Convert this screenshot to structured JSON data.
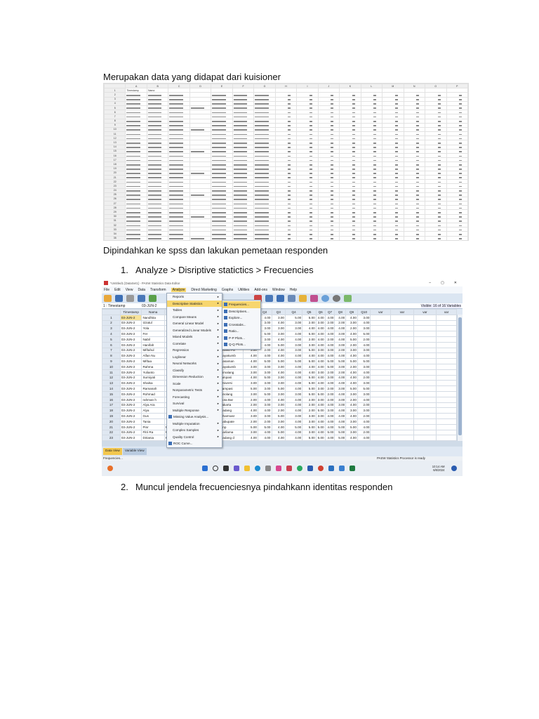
{
  "doc": {
    "intro": "Merupakan data yang didapat dari kuisioner",
    "move": "Dipindahkan ke spss  dan lakukan pemetaan responden",
    "steps": [
      {
        "num": "1.",
        "text": "Analyze > Disriptive statictics > Frecuencies"
      },
      {
        "num": "2.",
        "text": "Muncul jendela frecuenciesnya pindahkann identitas responden"
      }
    ]
  },
  "excel": {
    "columns": [
      "A",
      "B",
      "C",
      "D",
      "E",
      "F",
      "G",
      "H",
      "I",
      "J",
      "K",
      "L",
      "M",
      "N",
      "O",
      "P"
    ],
    "headers": [
      "Timestamp",
      "Nama"
    ],
    "row_count": 35
  },
  "spss": {
    "title": "*Untitled1 [DataSet1] - PASW Statistics Data Editor",
    "window_controls": [
      "–",
      "▢",
      "✕"
    ],
    "menu": [
      "File",
      "Edit",
      "View",
      "Data",
      "Transform",
      "Analyze",
      "Direct Marketing",
      "Graphs",
      "Utilities",
      "Add-ons",
      "Window",
      "Help"
    ],
    "active_menu": "Analyze",
    "cell_ref": "1 : Timestamp",
    "cell_value": "03-JUN-2",
    "visible_vars": "Visible: 16 of 16 Variables",
    "columns": [
      "",
      "Timestamp",
      "Nama",
      "",
      "",
      "",
      "",
      "Q1",
      "Q2",
      "Q3",
      "Q4",
      "Q5",
      "Q6",
      "Q7",
      "Q8",
      "Q9",
      "Q10",
      "var",
      "var",
      "var",
      "var"
    ],
    "rows": [
      [
        "1",
        "03-JUN-2",
        "Nandhita",
        "",
        "",
        "",
        "",
        "",
        "4.00",
        "3.00",
        "5.00",
        "5.00",
        "4.00",
        "4.00",
        "4.00",
        "4.00",
        "3.00"
      ],
      [
        "2",
        "03-JUN-2",
        "Izzatul",
        "",
        "",
        "",
        "",
        "",
        "3.00",
        "4.00",
        "3.00",
        "2.00",
        "3.00",
        "2.00",
        "2.00",
        "3.00",
        "4.00"
      ],
      [
        "3",
        "03-JUN-2",
        "Yola",
        "",
        "",
        "",
        "",
        "",
        "3.00",
        "3.00",
        "3.00",
        "4.00",
        "4.00",
        "4.00",
        "4.00",
        "2.00",
        "3.00"
      ],
      [
        "4",
        "03-JUN-2",
        "Fer",
        "",
        "",
        "",
        "",
        "",
        "5.00",
        "3.00",
        "4.00",
        "5.00",
        "4.00",
        "4.00",
        "3.00",
        "4.00",
        "5.00"
      ],
      [
        "5",
        "03-JUN-2",
        "Nabil",
        "",
        "",
        "",
        "",
        "",
        "3.00",
        "4.00",
        "4.00",
        "2.00",
        "4.00",
        "2.00",
        "4.00",
        "5.00",
        "2.00"
      ],
      [
        "6",
        "03-JUN-2",
        "Hanifah",
        "",
        "",
        "",
        "Univers",
        "4.00",
        "4.00",
        "5.00",
        "3.00",
        "3.00",
        "4.00",
        "4.00",
        "3.00",
        "2.00",
        "4.00"
      ],
      [
        "7",
        "03-JUN-2",
        "Miftahul",
        "",
        "",
        "",
        "Unand Pa",
        "3.00",
        "2.00",
        "4.00",
        "3.00",
        "5.00",
        "3.00",
        "3.00",
        "2.00",
        "3.00",
        "3.00"
      ],
      [
        "8",
        "03-JUN-2",
        "Alfan Nu",
        "",
        "",
        "",
        "Payakumb",
        "4.00",
        "4.00",
        "4.00",
        "4.00",
        "4.00",
        "4.00",
        "4.00",
        "4.00",
        "4.00",
        "4.00"
      ],
      [
        "9",
        "03-JUN-2",
        "Miftaa",
        "",
        "",
        "",
        "Pasaman",
        "4.00",
        "5.00",
        "5.00",
        "5.00",
        "5.00",
        "4.00",
        "5.00",
        "5.00",
        "5.00",
        "5.00"
      ],
      [
        "10",
        "03-JUN-2",
        "Rahma",
        "",
        "",
        "",
        "Payakumb",
        "3.00",
        "3.00",
        "3.00",
        "4.00",
        "4.00",
        "4.00",
        "5.00",
        "3.00",
        "2.00",
        "3.00"
      ],
      [
        "11",
        "03-JUN-2",
        "Yulianto",
        "",
        "",
        "",
        "Simalang",
        "3.00",
        "3.00",
        "4.00",
        "4.00",
        "4.00",
        "3.00",
        "2.00",
        "2.00",
        "4.00",
        "4.00"
      ],
      [
        "12",
        "03-JUN-2",
        "Sumiyati",
        "",
        "",
        "",
        "lampasi",
        "4.00",
        "5.00",
        "3.00",
        "4.00",
        "5.00",
        "4.00",
        "3.00",
        "4.00",
        "4.00",
        "2.00"
      ],
      [
        "13",
        "03-JUN-2",
        "Shalsa",
        "",
        "",
        "",
        "Universi",
        "3.00",
        "3.00",
        "3.00",
        "4.00",
        "5.00",
        "4.00",
        "4.00",
        "4.00",
        "4.00",
        "3.00"
      ],
      [
        "14",
        "03-JUN-2",
        "Ramanah",
        "",
        "",
        "",
        "Lampasi",
        "5.00",
        "3.00",
        "5.00",
        "4.00",
        "5.00",
        "3.00",
        "2.00",
        "3.00",
        "5.00",
        "5.00"
      ],
      [
        "15",
        "03-JUN-2",
        "Rohmad",
        "",
        "",
        "",
        "sinolang",
        "3.00",
        "5.00",
        "3.00",
        "3.00",
        "5.00",
        "5.00",
        "2.00",
        "4.00",
        "3.00",
        "3.00"
      ],
      [
        "16",
        "03-JUN-2",
        "rahman h",
        "",
        "",
        "",
        "Kota Bar",
        "2.00",
        "4.00",
        "4.00",
        "4.00",
        "2.00",
        "3.00",
        "2.00",
        "3.00",
        "2.00",
        "4.00"
      ],
      [
        "17",
        "03-JUN-2",
        "Alya Ara",
        "",
        "",
        "",
        "Jakarta",
        "2.00",
        "3.00",
        "3.00",
        "4.00",
        "2.00",
        "4.00",
        "4.00",
        "3.00",
        "4.00",
        "2.00"
      ],
      [
        "18",
        "03-JUN-2",
        "Alya",
        "",
        "",
        "",
        "Padang",
        "4.00",
        "4.00",
        "2.00",
        "4.00",
        "2.00",
        "5.00",
        "3.00",
        "4.00",
        "3.00",
        "3.00"
      ],
      [
        "19",
        "03-JUN-2",
        "Gus",
        "",
        "",
        "",
        "Dharmasr",
        "3.00",
        "3.00",
        "5.00",
        "3.00",
        "3.00",
        "3.00",
        "4.00",
        "4.00",
        "4.00",
        "2.00"
      ],
      [
        "20",
        "03-JUN-2",
        "Tania",
        "",
        "",
        "",
        "Kabupate",
        "2.00",
        "2.00",
        "3.00",
        "4.00",
        "3.00",
        "4.00",
        "4.00",
        "4.00",
        "3.00",
        "4.00"
      ],
      [
        "21",
        "03-JUN-2",
        "Pinr",
        "Perempua",
        "20",
        "SMA/SM",
        "Pnp",
        "5.00",
        "5.00",
        "4.00",
        "5.00",
        "5.00",
        "5.00",
        "4.00",
        "5.00",
        "5.00",
        "4.00"
      ],
      [
        "22",
        "03-JUN-2",
        "Fitri Ra",
        "Perempua",
        "25",
        "SMA/SM",
        "Sarilama",
        "3.00",
        "4.00",
        "5.00",
        "4.00",
        "3.00",
        "4.00",
        "5.00",
        "5.00",
        "3.00",
        "2.00"
      ],
      [
        "23",
        "03-JUN-2",
        "Diriania",
        "Perempua",
        "20",
        "SMA/SM",
        "Padang d",
        "4.00",
        "4.00",
        "4.00",
        "4.00",
        "5.00",
        "5.00",
        "4.00",
        "5.00",
        "4.00",
        "4.00"
      ]
    ],
    "tabs": [
      "Data View",
      "Variable View"
    ],
    "status_left": "Frequencies...",
    "status_right": "PASW Statistics Processor is ready",
    "clock": {
      "time": "10:14 AM",
      "date": "6/6/2024"
    },
    "analyze_menu": [
      {
        "label": "Reports",
        "sub": true
      },
      {
        "label": "Descriptive Statistics",
        "sub": true,
        "active": true
      },
      {
        "label": "Tables",
        "sub": true
      },
      {
        "label": "Compare Means",
        "sub": true
      },
      {
        "label": "General Linear Model",
        "sub": true
      },
      {
        "label": "Generalized Linear Models",
        "sub": true
      },
      {
        "label": "Mixed Models",
        "sub": true
      },
      {
        "label": "Correlate",
        "sub": true
      },
      {
        "label": "Regression",
        "sub": true
      },
      {
        "label": "Loglinear",
        "sub": true
      },
      {
        "label": "Neural Networks",
        "sub": true
      },
      {
        "label": "Classify",
        "sub": true
      },
      {
        "label": "Dimension Reduction",
        "sub": true
      },
      {
        "label": "Scale",
        "sub": true
      },
      {
        "label": "Nonparametric Tests",
        "sub": true
      },
      {
        "label": "Forecasting",
        "sub": true
      },
      {
        "label": "Survival",
        "sub": true
      },
      {
        "label": "Multiple Response",
        "sub": true
      },
      {
        "label": "Missing Value Analysis...",
        "sub": false
      },
      {
        "label": "Multiple Imputation",
        "sub": true
      },
      {
        "label": "Complex Samples",
        "sub": true
      },
      {
        "label": "Quality Control",
        "sub": true
      },
      {
        "label": "ROC Curve...",
        "sub": false
      }
    ],
    "descriptive_submenu": [
      "Frequencies...",
      "Descriptives...",
      "Explore...",
      "Crosstabs...",
      "Ratio...",
      "P-P Plots...",
      "Q-Q Plots..."
    ]
  },
  "colors": {
    "highlight": "#f7d66e",
    "spss_bg": "#dfe8f3",
    "header": "#dfe7f1"
  }
}
